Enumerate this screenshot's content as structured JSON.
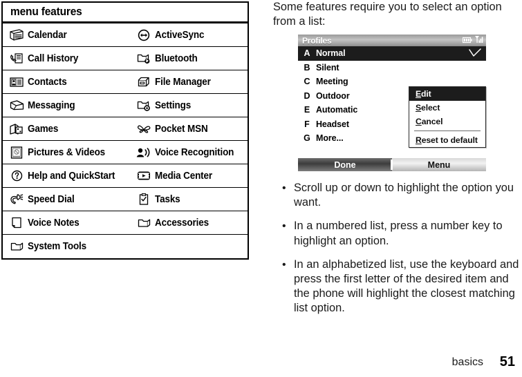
{
  "table": {
    "header": "menu features",
    "rows": [
      [
        {
          "icon": "calendar-icon",
          "label": "Calendar"
        },
        {
          "icon": "activesync-icon",
          "label": "ActiveSync"
        }
      ],
      [
        {
          "icon": "call-history-icon",
          "label": "Call History"
        },
        {
          "icon": "bluetooth-folder-icon",
          "label": "Bluetooth"
        }
      ],
      [
        {
          "icon": "contacts-icon",
          "label": "Contacts"
        },
        {
          "icon": "file-manager-icon",
          "label": "File Manager"
        }
      ],
      [
        {
          "icon": "messaging-envelope-icon",
          "label": "Messaging"
        },
        {
          "icon": "settings-gear-folder-icon",
          "label": "Settings"
        }
      ],
      [
        {
          "icon": "games-icon",
          "label": "Games"
        },
        {
          "icon": "pocket-msn-butterfly-icon",
          "label": "Pocket MSN"
        }
      ],
      [
        {
          "icon": "pictures-videos-icon",
          "label": "Pictures & Videos"
        },
        {
          "icon": "voice-recognition-icon",
          "label": "Voice Recognition"
        }
      ],
      [
        {
          "icon": "help-question-icon",
          "label": "Help and QuickStart"
        },
        {
          "icon": "media-center-icon",
          "label": "Media Center"
        }
      ],
      [
        {
          "icon": "speed-dial-hand-icon",
          "label": "Speed Dial"
        },
        {
          "icon": "tasks-checklist-icon",
          "label": "Tasks"
        }
      ],
      [
        {
          "icon": "voice-notes-icon",
          "label": "Voice Notes"
        },
        {
          "icon": "accessories-folder-icon",
          "label": "Accessories"
        }
      ],
      [
        {
          "icon": "system-tools-folder-icon",
          "label": "System Tools"
        },
        {
          "icon": "",
          "label": ""
        }
      ]
    ]
  },
  "intro": {
    "paragraph": "Some features require you to select an option from a list:"
  },
  "phone": {
    "title": "Profiles",
    "status_icons": [
      "battery-icon",
      "signal-icon"
    ],
    "list": [
      {
        "key": "A",
        "name": "Normal",
        "selected": true,
        "checked": true
      },
      {
        "key": "B",
        "name": "Silent",
        "selected": false,
        "checked": false
      },
      {
        "key": "C",
        "name": "Meeting",
        "selected": false,
        "checked": false
      },
      {
        "key": "D",
        "name": "Outdoor",
        "selected": false,
        "checked": false
      },
      {
        "key": "E",
        "name": "Automatic",
        "selected": false,
        "checked": false
      },
      {
        "key": "F",
        "name": "Headset",
        "selected": false,
        "checked": false
      },
      {
        "key": "G",
        "name": "More...",
        "selected": false,
        "checked": false
      }
    ],
    "menu": {
      "items": [
        {
          "accel": "E",
          "rest": "dit",
          "selected": true,
          "separator_after": false
        },
        {
          "accel": "S",
          "rest": "elect",
          "selected": false,
          "separator_after": false
        },
        {
          "accel": "C",
          "rest": "ancel",
          "selected": false,
          "separator_after": true
        },
        {
          "accel": "R",
          "rest": "eset to default",
          "selected": false,
          "separator_after": false
        }
      ]
    },
    "softkeys": {
      "left": "Done",
      "right": "Menu"
    }
  },
  "bullets": [
    "Scroll up or down to highlight the option you want.",
    "In a numbered list, press a number key to highlight an option.",
    "In an alphabetized list, use the keyboard and press the first letter of the desired item and the phone will highlight the closest matching list option."
  ],
  "bullet_marker": "•",
  "footer": {
    "section": "basics",
    "page_number": "51"
  },
  "colors": {
    "ink": "#000000",
    "page_bg": "#ffffff",
    "selection": "#1c1c1c"
  }
}
